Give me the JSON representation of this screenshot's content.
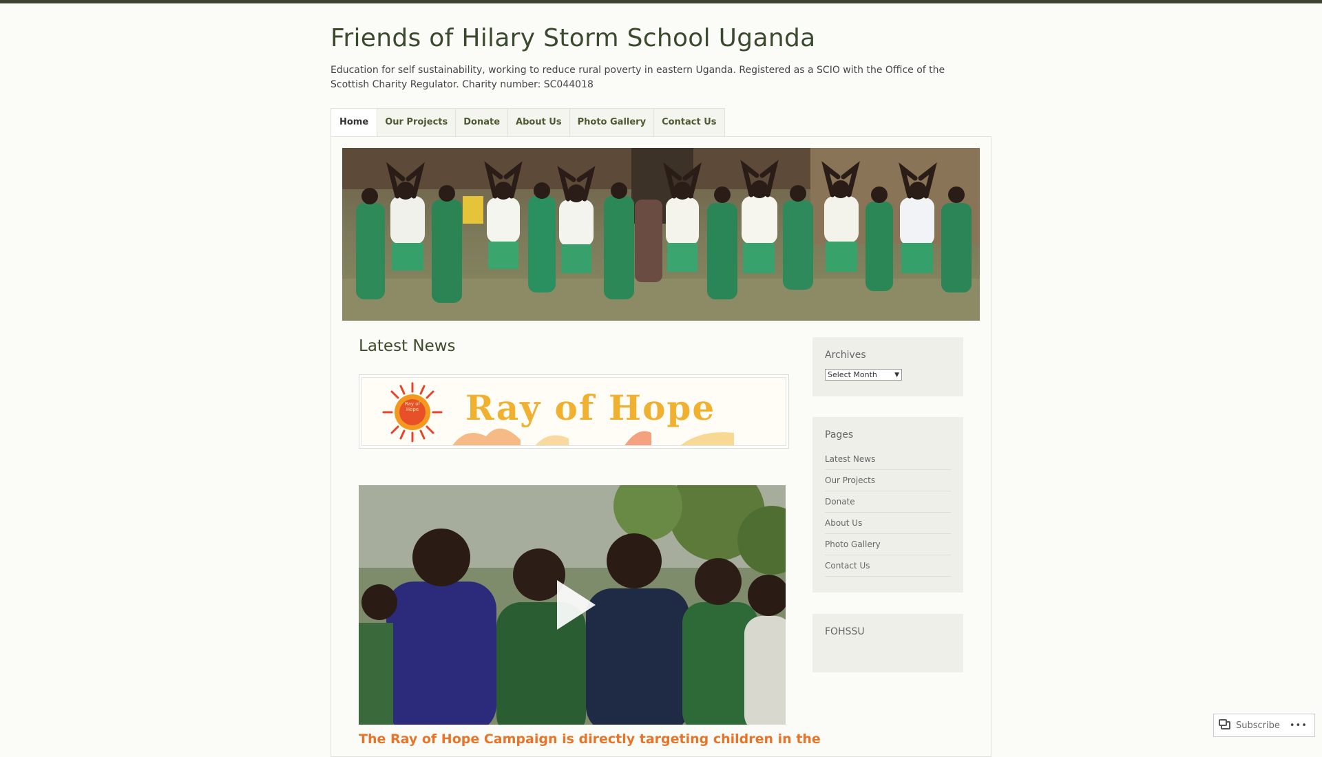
{
  "header": {
    "title": "Friends of Hilary Storm School Uganda",
    "description": "Education for self sustainability, working to reduce rural poverty in eastern Uganda. Registered as a SCIO with the Office of the Scottish Charity Regulator. Charity number: SC044018"
  },
  "nav": {
    "items": [
      {
        "label": "Home",
        "active": true
      },
      {
        "label": "Our Projects"
      },
      {
        "label": "Donate"
      },
      {
        "label": "About Us"
      },
      {
        "label": "Photo Gallery"
      },
      {
        "label": "Contact Us"
      }
    ]
  },
  "main": {
    "page_title": "Latest News",
    "banner_text": "Ray of Hope",
    "sun_text": "Ray of Hope",
    "post_title": "The Ray of Hope Campaign is directly targeting children in the"
  },
  "sidebar": {
    "archives": {
      "title": "Archives",
      "select_value": "Select Month"
    },
    "pages": {
      "title": "Pages",
      "items": [
        "Latest News",
        "Our Projects",
        "Donate",
        "About Us",
        "Photo Gallery",
        "Contact Us"
      ]
    },
    "fohssu": {
      "title": "FOHSSU"
    }
  },
  "footer": {
    "subscribe_label": "Subscribe",
    "more_label": "•••"
  },
  "colors": {
    "accent": "#3d4431",
    "post_title": "#e8742a",
    "nav_text": "#4c5a32"
  }
}
